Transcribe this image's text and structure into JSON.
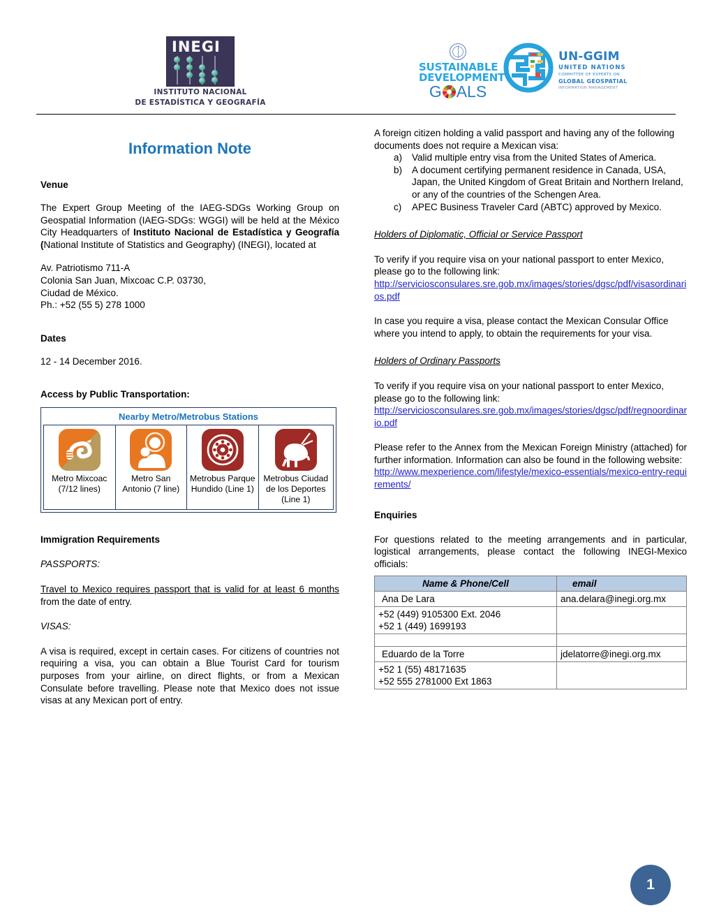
{
  "header": {
    "inegi_logo_word": "INEGI",
    "inegi_logo_line1": "INSTITUTO NACIONAL",
    "inegi_logo_line2": "DE ESTADÍSTICA Y GEOGRAFÍA",
    "sdg_line1": "SUSTAINABLE",
    "sdg_line2": "DEVELOPMENT",
    "sdg_line3a": "G",
    "sdg_line3b": "ALS",
    "ggim_line1": "UN-GGIM",
    "ggim_line2": "UNITED NATIONS",
    "ggim_line3": "COMMITTEE OF EXPERTS ON",
    "ggim_line4": "GLOBAL GEOSPATIAL",
    "ggim_line5": "INFORMATION MANAGEMENT"
  },
  "title": "Information Note",
  "left": {
    "venue_heading": "Venue",
    "venue_p1_a": "The Expert Group Meeting of the IAEG-SDGs Working Group on Geospatial Information (IAEG-SDGs: WGGI) will be held at the México City Headquarters of ",
    "venue_p1_b": "Instituto Nacional de Estadística y Geografía (",
    "venue_p1_c": "National Institute of Statistics and Geography) (INEGI), located at",
    "address_line1": "Av. Patriotismo 711-A",
    "address_line2": "Colonia San Juan, Mixcoac C.P. 03730,",
    "address_line3": "Ciudad de México.",
    "address_line4": "Ph.: +52 (55 5) 278 1000",
    "dates_heading": "Dates",
    "dates_value": "12 - 14 December 2016.",
    "access_heading": "Access by Public Transportation:",
    "metro_table_title": "Nearby Metro/Metrobus Stations",
    "metro_stations": [
      {
        "icon": "snake-head-icon",
        "label": "Metro Mixcoac\n(7/12 lines)"
      },
      {
        "icon": "saint-anthony-icon",
        "label": "Metro San Antonio\n(7 line)"
      },
      {
        "icon": "fountain-ring-icon",
        "label": "Metrobus Parque Hundido\n(Line 1)"
      },
      {
        "icon": "bull-icon",
        "label": "Metrobus Ciudad de los Deportes\n(Line 1)"
      }
    ],
    "immigration_heading": "Immigration Requirements",
    "passports_label": "PASSPORTS:",
    "passports_underlined": "Travel to Mexico requires passport that is valid for at least 6 months",
    "passports_rest": " from the date of entry.",
    "visas_label": "VISAS:",
    "visas_text": "A visa is required, except in certain cases. For citizens of countries not requiring a visa, you can obtain a Blue Tourist Card for tourism purposes from your airline, on direct flights, or from a Mexican Consulate before travelling. Please note that Mexico does not issue visas at any Mexican port of entry."
  },
  "right": {
    "intro": "A foreign citizen holding a valid passport and having any of the following documents does not require a Mexican visa:",
    "list": [
      {
        "marker": "a)",
        "text": "Valid multiple entry visa from the United States of America."
      },
      {
        "marker": "b)",
        "text": "A document certifying permanent residence in Canada, USA, Japan, the United Kingdom of Great Britain and Northern Ireland, or any of the countries of the Schengen Area."
      },
      {
        "marker": "c)",
        "text": "APEC Business Traveler Card (ABTC) approved by Mexico."
      }
    ],
    "diplomatic_heading": "Holders of Diplomatic, Official or Service Passport",
    "diplomatic_text": "To verify if you require visa on your national passport to enter Mexico, please go to the following link:",
    "diplomatic_link": "http://serviciosconsulares.sre.gob.mx/images/stories/dgsc/pdf/visasordinarios.pdf",
    "consular_text": "In case you require a visa, please contact the Mexican Consular Office where you intend to apply, to obtain the requirements for your visa.",
    "ordinary_heading": "Holders of Ordinary Passports",
    "ordinary_text": "To verify if you require visa on your national passport to enter Mexico, please go to the following link:",
    "ordinary_link": "http://serviciosconsulares.sre.gob.mx/images/stories/dgsc/pdf/regnoordinario.pdf",
    "annex_text": "Please refer to the Annex from the Mexican Foreign Ministry (attached) for further information. Information can also be found in the following website:",
    "annex_link": "http://www.mexperience.com/lifestyle/mexico-essentials/mexico-entry-requirements/",
    "enquiries_heading": "Enquiries",
    "enquiries_text": "For questions related to the meeting arrangements and in particular, logistical arrangements, please contact the following INEGI-Mexico officials:",
    "contacts_table": {
      "headers": [
        "Name & Phone/Cell",
        "email"
      ],
      "rows": [
        {
          "name": "Ana De Lara",
          "email": "ana.delara@inegi.org.mx"
        },
        {
          "phones": "+52 (449) 9105300 Ext. 2046\n+52 1 (449) 1699193",
          "email": ""
        },
        {
          "name": "",
          "email": ""
        },
        {
          "name": "Eduardo de la Torre",
          "email": "jdelatorre@inegi.org.mx"
        },
        {
          "phones": "+52 1 (55) 48171635\n+52 555 2781000 Ext 1863",
          "email": ""
        }
      ]
    }
  },
  "page_number": "1",
  "colors": {
    "title_blue": "#1b75bb",
    "link_blue": "#2222cc",
    "table_border": "#1f3864",
    "table_header_fill": "#b8cce4",
    "page_badge": "#3c6596",
    "metro_orange": "#e87722",
    "metrobus_red": "#9e2b25"
  }
}
